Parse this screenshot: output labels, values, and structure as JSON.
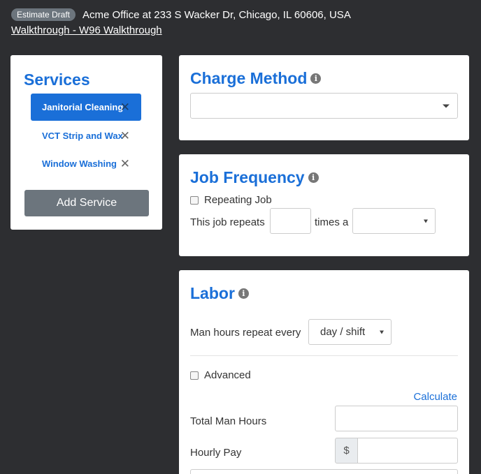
{
  "header": {
    "badge": "Estimate Draft",
    "address": "Acme Office at 233 S Wacker Dr, Chicago, IL 60606, USA",
    "walkthrough_link": "Walkthrough - W96 Walkthrough"
  },
  "services": {
    "title": "Services",
    "items": [
      {
        "label": "Janitorial Cleaning",
        "active": true
      },
      {
        "label": "VCT Strip and Wax",
        "active": false
      },
      {
        "label": "Window Washing",
        "active": false
      }
    ],
    "remove_glyph": "✕",
    "add_label": "Add Service"
  },
  "charge_method": {
    "title": "Charge Method",
    "info_glyph": "i",
    "select_value": ""
  },
  "job_frequency": {
    "title": "Job Frequency",
    "info_glyph": "i",
    "repeating_label": "Repeating Job",
    "repeats_prefix": "This job repeats",
    "times_value": "",
    "times_a_label": "times a",
    "period_value": ""
  },
  "labor": {
    "title": "Labor",
    "info_glyph": "i",
    "man_hours_label": "Man hours repeat every",
    "man_hours_select": "day / shift",
    "advanced_label": "Advanced",
    "calculate_link": "Calculate",
    "total_man_hours_label": "Total Man Hours",
    "total_man_hours_value": "",
    "hourly_pay_label": "Hourly Pay",
    "currency_symbol": "$",
    "hourly_pay_value": ""
  }
}
